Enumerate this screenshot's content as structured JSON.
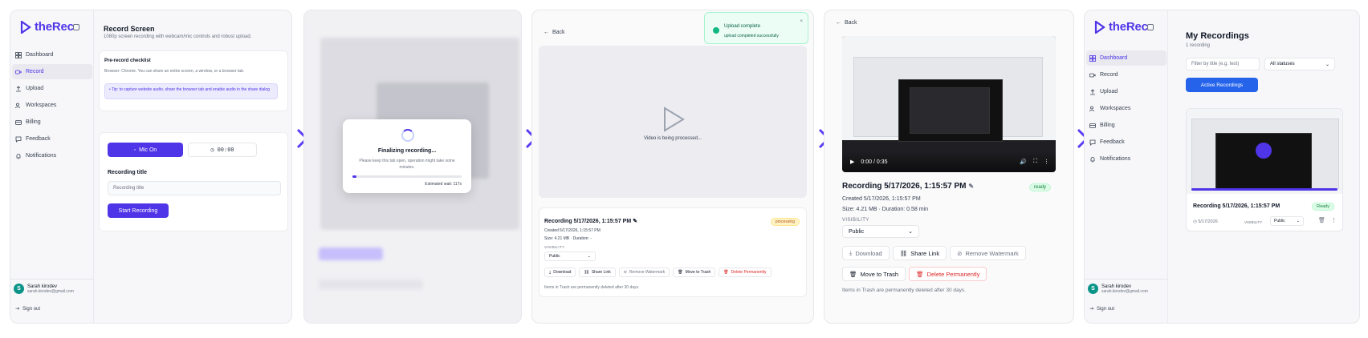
{
  "brand": {
    "name": "theRec",
    "accent": "#4f35e8"
  },
  "sidebar": {
    "items": [
      {
        "label": "Dashboard",
        "icon": "dashboard-icon"
      },
      {
        "label": "Record",
        "icon": "video-icon"
      },
      {
        "label": "Upload",
        "icon": "upload-icon"
      },
      {
        "label": "Workspaces",
        "icon": "users-icon"
      },
      {
        "label": "Billing",
        "icon": "card-icon"
      },
      {
        "label": "Feedback",
        "icon": "chat-icon"
      },
      {
        "label": "Notifications",
        "icon": "bell-icon"
      }
    ],
    "user": {
      "initial": "S",
      "name": "Sarah kirodev",
      "email": "sarah.kirodev@gmail.com"
    },
    "signout": "Sign out"
  },
  "record": {
    "title": "Record Screen",
    "subtitle": "1080p screen recording with webcam/mic controls and robust upload.",
    "checklist_title": "Pre-record checklist",
    "checklist_text": "Browser: Chrome. You can share an entire screen, a window, or a browser tab.",
    "tip": "• Tip: to capture website audio, share the browser tab and enable audio in the share dialog",
    "mic_label": "Mic On",
    "timer": "00:00",
    "title_label": "Recording title",
    "title_placeholder": "Recording title",
    "start_label": "Start Recording"
  },
  "finalizing": {
    "title": "Finalizing recording...",
    "text": "Please keep this tab open, operation might take some minutes.",
    "estimate": "Estimated wait: 117s",
    "progress": 0.04
  },
  "processing": {
    "back": "Back",
    "toast_title": "Upload complete",
    "toast_text": "upload completed successfully",
    "toast_close": "×",
    "video_text": "Video is being processed...",
    "rec_title": "Recording 5/17/2026, 1:15:57 PM",
    "status": "processing",
    "created": "Created 5/17/2026, 1:15:57 PM",
    "size": "Size: 4.21 MB · Duration: -",
    "visibility_label": "VISIBILITY",
    "visibility_value": "Public",
    "actions": [
      "Download",
      "Share Link",
      "Remove Watermark",
      "Move to Trash",
      "Delete Permanently"
    ],
    "trash_note": "Items in Trash are permanently deleted after 30 days."
  },
  "ready": {
    "back": "Back",
    "time": "0:00 / 0:35",
    "rec_title": "Recording 5/17/2026, 1:15:57 PM",
    "status": "ready",
    "created": "Created 5/17/2026, 1:15:57 PM",
    "size": "Size: 4.21 MB · Duration: 0.58 min",
    "visibility_label": "VISIBILITY",
    "visibility_value": "Public",
    "actions": [
      "Download",
      "Share Link",
      "Remove Watermark",
      "Move to Trash",
      "Delete Permanently"
    ],
    "trash_note": "Items in Trash are permanently deleted after 30 days."
  },
  "recordings": {
    "title": "My Recordings",
    "count": "1 recording",
    "filter_placeholder": "Filter by title (e.g. test)",
    "status_filter": "All statuses",
    "active_button": "Active Recordings",
    "card_title": "Recording 5/17/2026, 1:15:57 PM",
    "card_status": "Ready",
    "card_date": "5/17/2026",
    "card_visibility_label": "VISIBILITY",
    "card_visibility": "Public"
  }
}
